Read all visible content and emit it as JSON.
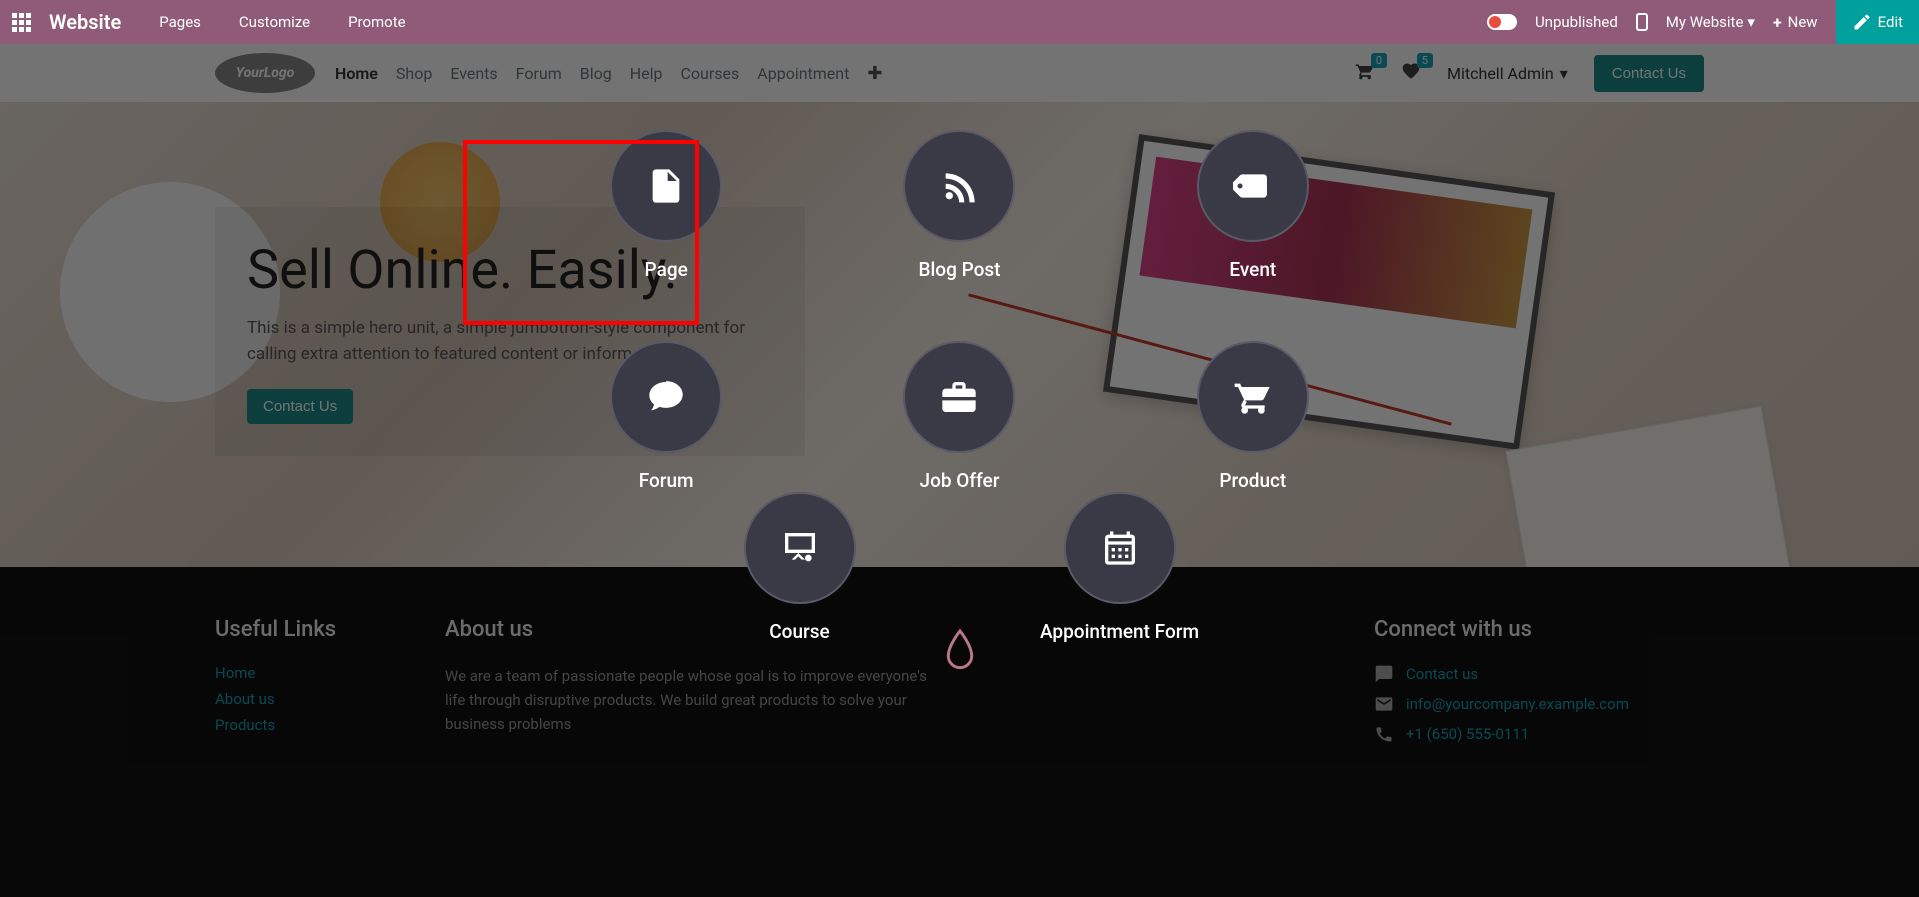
{
  "topbar": {
    "brand": "Website",
    "menu": {
      "pages": "Pages",
      "customize": "Customize",
      "promote": "Promote"
    },
    "status": "Unpublished",
    "website_selector": "My Website",
    "new": "New",
    "edit": "Edit"
  },
  "siteheader": {
    "logo_text": "YourLogo",
    "nav": {
      "home": "Home",
      "shop": "Shop",
      "events": "Events",
      "forum": "Forum",
      "blog": "Blog",
      "help": "Help",
      "courses": "Courses",
      "appointment": "Appointment"
    },
    "cart_badge": "0",
    "wish_badge": "5",
    "user": "Mitchell Admin",
    "contact": "Contact Us"
  },
  "hero": {
    "title": "Sell Online. Easily.",
    "subtitle": "This is a simple hero unit, a simple jumbotron-style component for calling extra attention to featured content or information.",
    "cta": "Contact Us"
  },
  "new_modal": {
    "page": "Page",
    "blog_post": "Blog Post",
    "event": "Event",
    "forum": "Forum",
    "job_offer": "Job Offer",
    "product": "Product",
    "course": "Course",
    "appointment_form": "Appointment Form"
  },
  "footer": {
    "links_title": "Useful Links",
    "links": {
      "home": "Home",
      "about": "About us",
      "products": "Products"
    },
    "about_title": "About us",
    "about_text": "We are a team of passionate people whose goal is to improve everyone's life through disruptive products. We build great products to solve your business problems",
    "connect_title": "Connect with us",
    "connect": {
      "contact": "Contact us",
      "email": "info@yourcompany.example.com",
      "phone": "+1 (650) 555-0111"
    }
  },
  "colors": {
    "topbar": "#8f5b78",
    "edit": "#00a09d",
    "teal": "#1b8b89",
    "link": "#17a2b8"
  }
}
